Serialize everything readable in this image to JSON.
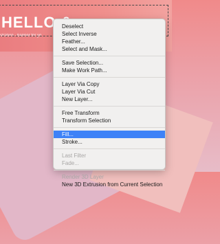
{
  "canvas": {
    "headline": "HELLO & ",
    "tagline": "stration - banner for yo"
  },
  "menu": {
    "groups": [
      [
        {
          "label": "Deselect",
          "enabled": true
        },
        {
          "label": "Select Inverse",
          "enabled": true
        },
        {
          "label": "Feather...",
          "enabled": true
        },
        {
          "label": "Select and Mask...",
          "enabled": true
        }
      ],
      [
        {
          "label": "Save Selection...",
          "enabled": true
        },
        {
          "label": "Make Work Path...",
          "enabled": true
        }
      ],
      [
        {
          "label": "Layer Via Copy",
          "enabled": true
        },
        {
          "label": "Layer Via Cut",
          "enabled": true
        },
        {
          "label": "New Layer...",
          "enabled": true
        }
      ],
      [
        {
          "label": "Free Transform",
          "enabled": true
        },
        {
          "label": "Transform Selection",
          "enabled": true
        }
      ],
      [
        {
          "label": "Fill...",
          "enabled": true,
          "highlighted": true
        },
        {
          "label": "Stroke...",
          "enabled": true
        }
      ],
      [
        {
          "label": "Last Filter",
          "enabled": false
        },
        {
          "label": "Fade...",
          "enabled": false
        }
      ],
      [
        {
          "label": "Render 3D Layer",
          "enabled": false
        },
        {
          "label": "New 3D Extrusion from Current Selection",
          "enabled": true
        }
      ]
    ]
  },
  "colors": {
    "highlight": "#3e82f7",
    "menu_bg": "#f1f0ef",
    "disabled_text": "#a8a6a5"
  }
}
